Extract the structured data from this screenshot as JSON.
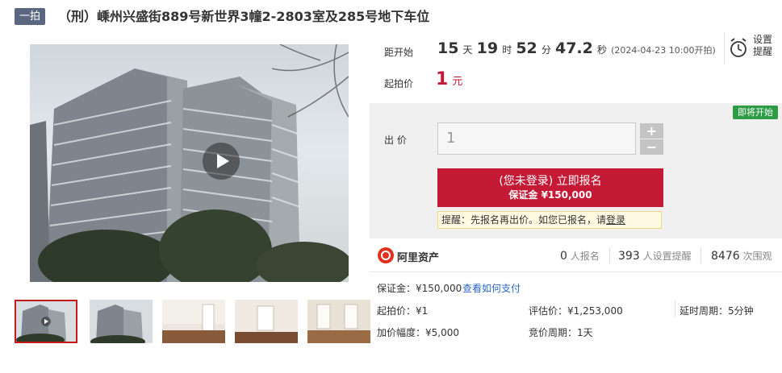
{
  "header": {
    "badge": "一拍",
    "title": "（刑）嵊州兴盛街889号新世界3幢2-2803室及285号地下车位"
  },
  "countdown": {
    "label": "距开始",
    "days": "15",
    "days_unit": "天",
    "hours": "19",
    "hours_unit": "时",
    "minutes": "52",
    "minutes_unit": "分",
    "seconds": "47.2",
    "seconds_unit": "秒",
    "start_note": "(2024-04-23 10:00开拍)"
  },
  "reminder": {
    "line1": "设置",
    "line2": "提醒",
    "icon": "alarm-clock-icon"
  },
  "start_price": {
    "label": "起拍价",
    "value": "1",
    "unit": "元"
  },
  "status_tag": "即将开始",
  "bid": {
    "label": "出 价",
    "value": "1",
    "plus": "+",
    "minus": "−"
  },
  "signup": {
    "line1": "(您未登录) 立即报名",
    "line2": "保证金 ¥150,000"
  },
  "tip": {
    "text": "提醒：先报名再出价。如您已报名，请",
    "link": "登录"
  },
  "platform": {
    "name": "阿里资产",
    "signups": "0",
    "signups_label": "人报名",
    "reminders": "393",
    "reminders_label": "人设置提醒",
    "views": "8476",
    "views_label": "次围观"
  },
  "details": {
    "deposit": "保证金：¥150,000",
    "pay_link": "查看如何支付",
    "start_price": "起拍价：¥1",
    "appraisal": "评估价：¥1,253,000",
    "delay": "延时周期：5分钟",
    "increment": "加价幅度：¥5,000",
    "cycle": "竞价周期：1天"
  },
  "colors": {
    "accent_red": "#c41a36",
    "badge_bg": "#5b6780",
    "tag_green": "#2d9c44",
    "link_blue": "#2a67c7"
  }
}
